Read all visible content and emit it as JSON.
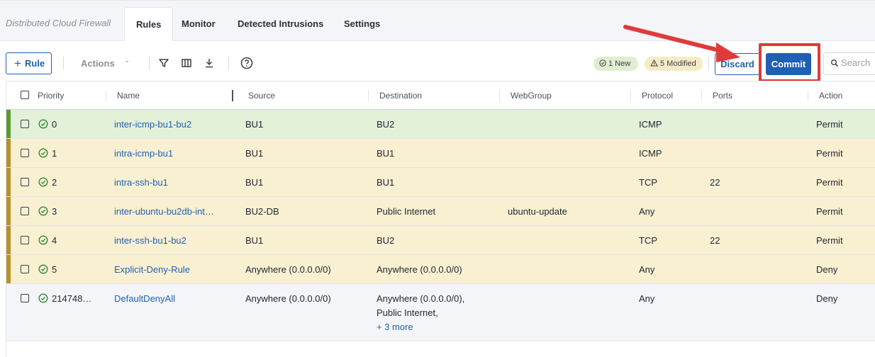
{
  "app": {
    "title": "Distributed Cloud Firewall"
  },
  "tabs": [
    {
      "label": "Rules"
    },
    {
      "label": "Monitor"
    },
    {
      "label": "Detected Intrusions"
    },
    {
      "label": "Settings"
    }
  ],
  "toolbar": {
    "add_rule_label": "Rule",
    "actions_label": "Actions",
    "new_badge": "1 New",
    "modified_badge": "5 Modified",
    "discard_label": "Discard",
    "commit_label": "Commit",
    "search_placeholder": "Search"
  },
  "table": {
    "columns": [
      "Priority",
      "Name",
      "Source",
      "Destination",
      "WebGroup",
      "Protocol",
      "Ports",
      "Action"
    ],
    "rows": [
      {
        "priority": "0",
        "name": "inter-icmp-bu1-bu2",
        "source": "BU1",
        "destination": "BU2",
        "webgroup": "",
        "protocol": "ICMP",
        "ports": "",
        "action": "Permit",
        "state": "new"
      },
      {
        "priority": "1",
        "name": "intra-icmp-bu1",
        "source": "BU1",
        "destination": "BU1",
        "webgroup": "",
        "protocol": "ICMP",
        "ports": "",
        "action": "Permit",
        "state": "modified"
      },
      {
        "priority": "2",
        "name": "intra-ssh-bu1",
        "source": "BU1",
        "destination": "BU1",
        "webgroup": "",
        "protocol": "TCP",
        "ports": "22",
        "action": "Permit",
        "state": "modified"
      },
      {
        "priority": "3",
        "name": "inter-ubuntu-bu2db-int…",
        "source": "BU2-DB",
        "destination": "Public Internet",
        "webgroup": "ubuntu-update",
        "protocol": "Any",
        "ports": "",
        "action": "Permit",
        "state": "modified"
      },
      {
        "priority": "4",
        "name": "inter-ssh-bu1-bu2",
        "source": "BU1",
        "destination": "BU2",
        "webgroup": "",
        "protocol": "TCP",
        "ports": "22",
        "action": "Permit",
        "state": "modified"
      },
      {
        "priority": "5",
        "name": "Explicit-Deny-Rule",
        "source": "Anywhere (0.0.0.0/0)",
        "destination": "Anywhere (0.0.0.0/0)",
        "webgroup": "",
        "protocol": "Any",
        "ports": "",
        "action": "Deny",
        "state": "modified"
      },
      {
        "priority": "214748…",
        "name": "DefaultDenyAll",
        "source": "Anywhere (0.0.0.0/0)",
        "destination_lines": [
          "Anywhere (0.0.0.0/0),",
          "Public Internet,"
        ],
        "destination_more": "+ 3 more",
        "webgroup": "",
        "protocol": "Any",
        "ports": "",
        "action": "Deny",
        "state": "default"
      }
    ]
  },
  "colors": {
    "accent": "#1f5fb4",
    "new_marker": "#5d9a2e",
    "modified_marker": "#b8902a",
    "callout": "#e03a3a",
    "status_ok": "#2e8b3a"
  }
}
